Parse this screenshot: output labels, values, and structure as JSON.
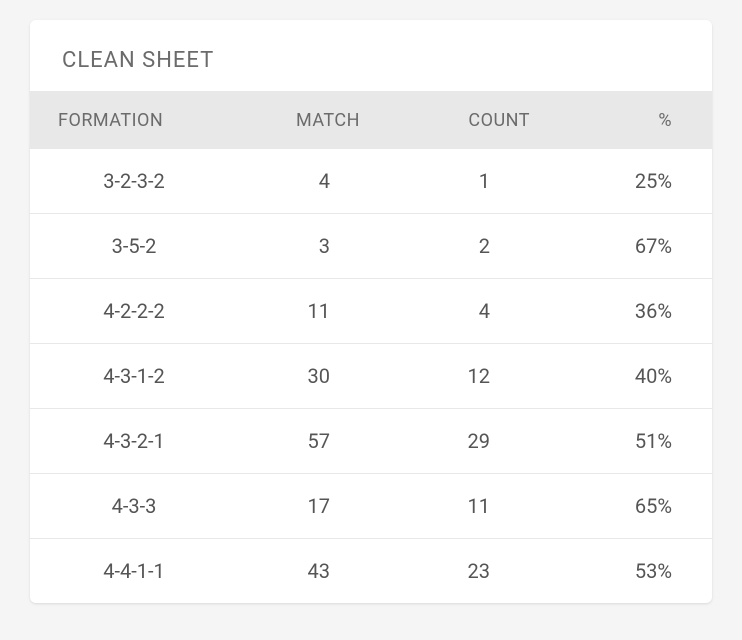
{
  "title": "CLEAN SHEET",
  "columns": {
    "formation": "FORMATION",
    "match": "MATCH",
    "count": "COUNT",
    "percent": "%"
  },
  "rows": [
    {
      "formation": "3-2-3-2",
      "match": "4",
      "count": "1",
      "percent": "25%"
    },
    {
      "formation": "3-5-2",
      "match": "3",
      "count": "2",
      "percent": "67%"
    },
    {
      "formation": "4-2-2-2",
      "match": "11",
      "count": "4",
      "percent": "36%"
    },
    {
      "formation": "4-3-1-2",
      "match": "30",
      "count": "12",
      "percent": "40%"
    },
    {
      "formation": "4-3-2-1",
      "match": "57",
      "count": "29",
      "percent": "51%"
    },
    {
      "formation": "4-3-3",
      "match": "17",
      "count": "11",
      "percent": "65%"
    },
    {
      "formation": "4-4-1-1",
      "match": "43",
      "count": "23",
      "percent": "53%"
    }
  ],
  "chart_data": {
    "type": "table",
    "title": "CLEAN SHEET",
    "columns": [
      "FORMATION",
      "MATCH",
      "COUNT",
      "%"
    ],
    "rows": [
      [
        "3-2-3-2",
        4,
        1,
        25
      ],
      [
        "3-5-2",
        3,
        2,
        67
      ],
      [
        "4-2-2-2",
        11,
        4,
        36
      ],
      [
        "4-3-1-2",
        30,
        12,
        40
      ],
      [
        "4-3-2-1",
        57,
        29,
        51
      ],
      [
        "4-3-3",
        17,
        11,
        65
      ],
      [
        "4-4-1-1",
        43,
        23,
        53
      ]
    ]
  }
}
